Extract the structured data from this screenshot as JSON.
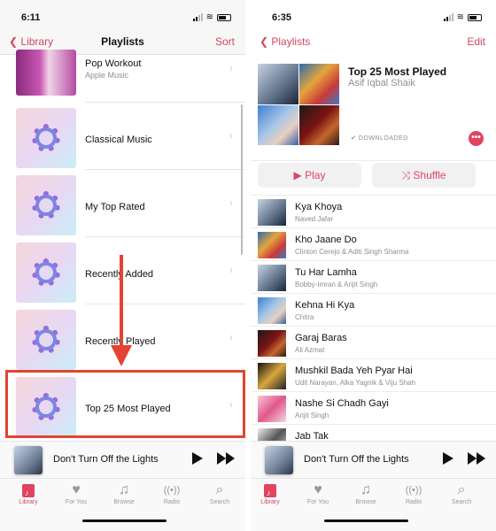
{
  "left": {
    "status": {
      "time": "6:11"
    },
    "nav": {
      "back": "Library",
      "title": "Playlists",
      "action": "Sort"
    },
    "playlists": [
      {
        "name": "Pop Workout",
        "subtitle": "Apple Music"
      },
      {
        "name": "Classical Music"
      },
      {
        "name": "My Top Rated"
      },
      {
        "name": "Recently Added"
      },
      {
        "name": "Recently Played"
      },
      {
        "name": "Top 25 Most Played"
      }
    ],
    "annotation_color": "#e44332"
  },
  "right": {
    "status": {
      "time": "6:35"
    },
    "nav": {
      "back": "Playlists",
      "action": "Edit"
    },
    "playlist": {
      "title": "Top 25 Most Played",
      "owner": "Asif Iqbal Shaik",
      "status": "DOWNLOADED"
    },
    "buttons": {
      "play": "Play",
      "shuffle": "Shuffle"
    },
    "tracks": [
      {
        "title": "Kya Khoya",
        "artist": "Naved Jafar"
      },
      {
        "title": "Kho Jaane Do",
        "artist": "Clinton Cerejo & Aditi Singh Sharma"
      },
      {
        "title": "Tu Har Lamha",
        "artist": "Bobby-Imran & Arijit Singh"
      },
      {
        "title": "Kehna Hi Kya",
        "artist": "Chitra"
      },
      {
        "title": "Garaj Baras",
        "artist": "Ali Azmat"
      },
      {
        "title": "Mushkil Bada Yeh Pyar Hai",
        "artist": "Udit Narayan, Alka Yagnik & Viju Shah"
      },
      {
        "title": "Nashe Si Chadh Gayi",
        "artist": "Arijit Singh"
      },
      {
        "title": "Jab Tak",
        "artist": ""
      }
    ]
  },
  "mini_player": {
    "title": "Don't Turn Off the Lights"
  },
  "tabs": [
    "Library",
    "For You",
    "Browse",
    "Radio",
    "Search"
  ],
  "accent": "#e0445f"
}
